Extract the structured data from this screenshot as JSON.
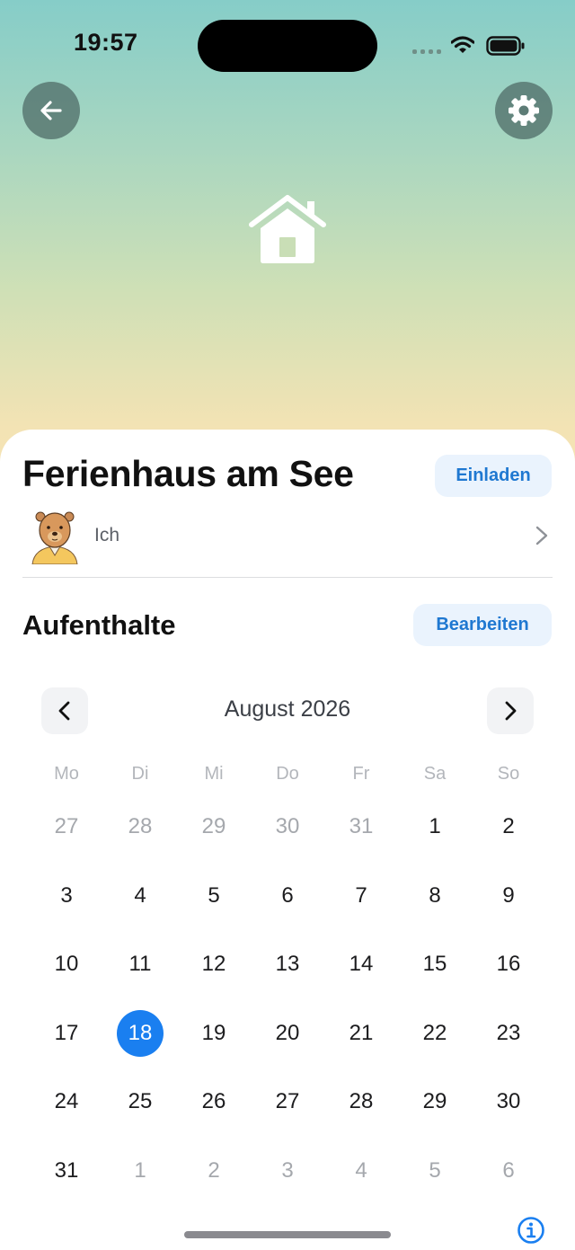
{
  "status_bar": {
    "time": "19:57"
  },
  "header": {
    "back_icon": "arrow-left-icon",
    "settings_icon": "gear-icon",
    "hero_icon": "house-icon"
  },
  "colors": {
    "accent": "#1a7ff0",
    "button_text": "#1f78d1",
    "button_bg": "#eaf3fd"
  },
  "home": {
    "title": "Ferienhaus am See",
    "invite_label": "Einladen"
  },
  "members": [
    {
      "name": "Ich"
    }
  ],
  "stays": {
    "title": "Aufenthalte",
    "edit_label": "Bearbeiten"
  },
  "calendar": {
    "month_label": "August 2026",
    "weekdays": [
      "Mo",
      "Di",
      "Mi",
      "Do",
      "Fr",
      "Sa",
      "So"
    ],
    "days": [
      {
        "label": "27",
        "muted": true,
        "selected": false
      },
      {
        "label": "28",
        "muted": true,
        "selected": false
      },
      {
        "label": "29",
        "muted": true,
        "selected": false
      },
      {
        "label": "30",
        "muted": true,
        "selected": false
      },
      {
        "label": "31",
        "muted": true,
        "selected": false
      },
      {
        "label": "1",
        "muted": false,
        "selected": false
      },
      {
        "label": "2",
        "muted": false,
        "selected": false
      },
      {
        "label": "3",
        "muted": false,
        "selected": false
      },
      {
        "label": "4",
        "muted": false,
        "selected": false
      },
      {
        "label": "5",
        "muted": false,
        "selected": false
      },
      {
        "label": "6",
        "muted": false,
        "selected": false
      },
      {
        "label": "7",
        "muted": false,
        "selected": false
      },
      {
        "label": "8",
        "muted": false,
        "selected": false
      },
      {
        "label": "9",
        "muted": false,
        "selected": false
      },
      {
        "label": "10",
        "muted": false,
        "selected": false
      },
      {
        "label": "11",
        "muted": false,
        "selected": false
      },
      {
        "label": "12",
        "muted": false,
        "selected": false
      },
      {
        "label": "13",
        "muted": false,
        "selected": false
      },
      {
        "label": "14",
        "muted": false,
        "selected": false
      },
      {
        "label": "15",
        "muted": false,
        "selected": false
      },
      {
        "label": "16",
        "muted": false,
        "selected": false
      },
      {
        "label": "17",
        "muted": false,
        "selected": false
      },
      {
        "label": "18",
        "muted": false,
        "selected": true
      },
      {
        "label": "19",
        "muted": false,
        "selected": false
      },
      {
        "label": "20",
        "muted": false,
        "selected": false
      },
      {
        "label": "21",
        "muted": false,
        "selected": false
      },
      {
        "label": "22",
        "muted": false,
        "selected": false
      },
      {
        "label": "23",
        "muted": false,
        "selected": false
      },
      {
        "label": "24",
        "muted": false,
        "selected": false
      },
      {
        "label": "25",
        "muted": false,
        "selected": false
      },
      {
        "label": "26",
        "muted": false,
        "selected": false
      },
      {
        "label": "27",
        "muted": false,
        "selected": false
      },
      {
        "label": "28",
        "muted": false,
        "selected": false
      },
      {
        "label": "29",
        "muted": false,
        "selected": false
      },
      {
        "label": "30",
        "muted": false,
        "selected": false
      },
      {
        "label": "31",
        "muted": false,
        "selected": false
      },
      {
        "label": "1",
        "muted": true,
        "selected": false
      },
      {
        "label": "2",
        "muted": true,
        "selected": false
      },
      {
        "label": "3",
        "muted": true,
        "selected": false
      },
      {
        "label": "4",
        "muted": true,
        "selected": false
      },
      {
        "label": "5",
        "muted": true,
        "selected": false
      },
      {
        "label": "6",
        "muted": true,
        "selected": false
      }
    ]
  },
  "footer": {
    "info_icon": "info-icon"
  }
}
